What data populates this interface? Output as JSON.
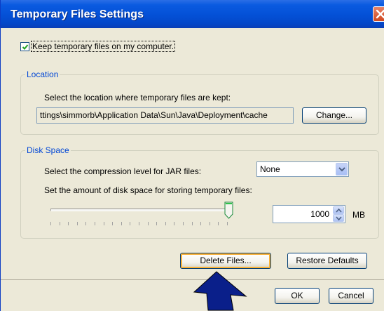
{
  "window": {
    "title": "Temporary Files Settings"
  },
  "keep_files": {
    "label": "Keep temporary files on my computer.",
    "checked": true
  },
  "location": {
    "legend": "Location",
    "description": "Select the location where temporary files are kept:",
    "path": "ttings\\simmorb\\Application Data\\Sun\\Java\\Deployment\\cache",
    "change_label": "Change..."
  },
  "disk_space": {
    "legend": "Disk Space",
    "compression_label": "Select the compression level for JAR files:",
    "compression_value": "None",
    "amount_label": "Set the amount of disk space for storing temporary files:",
    "amount_value": "1000",
    "unit": "MB",
    "slider_fraction": 1.0
  },
  "actions": {
    "delete_label": "Delete Files...",
    "restore_label": "Restore Defaults",
    "ok_label": "OK",
    "cancel_label": "Cancel"
  },
  "colors": {
    "titlebar": "#0450d6",
    "legend_text": "#0046d5",
    "dialog_bg": "#ece9d8",
    "focus_highlight": "#f9b23a",
    "annotation_arrow": "#0a1f8a"
  },
  "icons": [
    "close-icon",
    "checkmark-icon",
    "dropdown-arrow-icon",
    "spin-up-icon",
    "spin-down-icon",
    "slider-thumb-icon",
    "pointer-arrow-icon"
  ]
}
